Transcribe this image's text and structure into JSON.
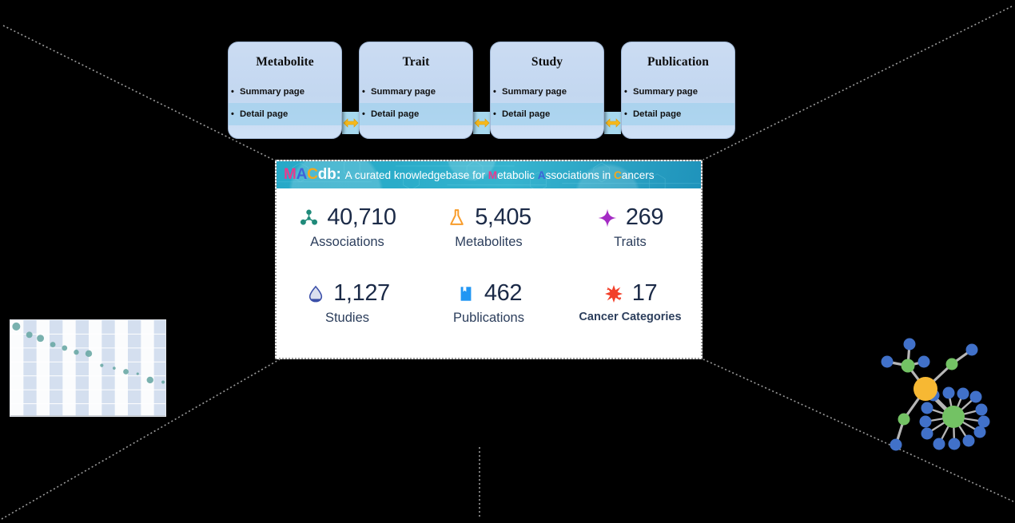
{
  "figure": {
    "background_color": "#000000",
    "perspective_line_color": "#9a9a9a"
  },
  "flow_cards": {
    "connector_icon": "double-arrow-icon",
    "connector_color": "#f5b91c",
    "band_color": "#a6d8ee",
    "items": [
      {
        "title": "Metabolite",
        "bullets": [
          "Summary page",
          "Detail page"
        ]
      },
      {
        "title": "Trait",
        "bullets": [
          "Summary page",
          "Detail page"
        ]
      },
      {
        "title": "Study",
        "bullets": [
          "Summary page",
          "Detail page"
        ]
      },
      {
        "title": "Publication",
        "bullets": [
          "Summary page",
          "Detail page"
        ]
      }
    ]
  },
  "panel": {
    "banner": {
      "logo": {
        "m": "M",
        "a": "A",
        "c": "C",
        "db": "db:"
      },
      "tagline_prefix": "A curated knowledgebase for ",
      "tagline_m": "M",
      "tagline_metabolic_rest": "etabolic ",
      "tagline_a": "A",
      "tagline_assoc_rest": "ssociations in ",
      "tagline_c": "C",
      "tagline_cancers_rest": "ancers",
      "colors": {
        "m": "#ea3a8e",
        "a": "#3f63d8",
        "c": "#f5a81c",
        "background": "#2ba9c7"
      }
    },
    "stats": [
      {
        "value": "40,710",
        "label": "Associations",
        "icon": "molecule-icon",
        "icon_color": "#1f8a7a",
        "bold_label": false
      },
      {
        "value": "5,405",
        "label": "Metabolites",
        "icon": "flask-icon",
        "icon_color": "#f89c2a",
        "bold_label": false
      },
      {
        "value": "269",
        "label": "Traits",
        "icon": "sparkle-icon",
        "icon_color": "#a42bc4",
        "bold_label": false
      },
      {
        "value": "1,127",
        "label": "Studies",
        "icon": "droplet-icon",
        "icon_color": "#3b4fa8",
        "bold_label": false
      },
      {
        "value": "462",
        "label": "Publications",
        "icon": "bookmark-icon",
        "icon_color": "#2196f3",
        "bold_label": false
      },
      {
        "value": "17",
        "label": "Cancer Categories",
        "icon": "splat-icon",
        "icon_color": "#f2402a",
        "bold_label": true
      }
    ]
  },
  "chart_data": {
    "type": "scatter",
    "title": "",
    "xlabel": "",
    "ylabel": "",
    "grid": true,
    "band_color": "#ccd9ec",
    "point_color": "#6aa9a5",
    "xlim": [
      0,
      12
    ],
    "ylim": [
      0,
      7
    ],
    "points": [
      {
        "x": 0.45,
        "y": 6.55,
        "size": 9.5
      },
      {
        "x": 1.45,
        "y": 5.95,
        "size": 7.5
      },
      {
        "x": 2.3,
        "y": 5.7,
        "size": 8.5
      },
      {
        "x": 3.25,
        "y": 5.25,
        "size": 6.5
      },
      {
        "x": 4.15,
        "y": 5.0,
        "size": 6.5
      },
      {
        "x": 5.05,
        "y": 4.7,
        "size": 6.0
      },
      {
        "x": 6.0,
        "y": 4.6,
        "size": 8.0
      },
      {
        "x": 7.0,
        "y": 3.75,
        "size": 4.0
      },
      {
        "x": 7.95,
        "y": 3.55,
        "size": 3.5
      },
      {
        "x": 8.85,
        "y": 3.3,
        "size": 6.5
      },
      {
        "x": 9.75,
        "y": 3.15,
        "size": 3.0
      },
      {
        "x": 10.7,
        "y": 2.7,
        "size": 8.0
      },
      {
        "x": 11.7,
        "y": 2.55,
        "size": 4.0
      }
    ]
  },
  "network": {
    "hub_color": "#f7b833",
    "mid_color": "#73c264",
    "leaf_color": "#4171c9",
    "edge_color": "#b6b6b6",
    "node_counts": {
      "hub": 1,
      "mid": 4,
      "leaf": 22
    }
  }
}
